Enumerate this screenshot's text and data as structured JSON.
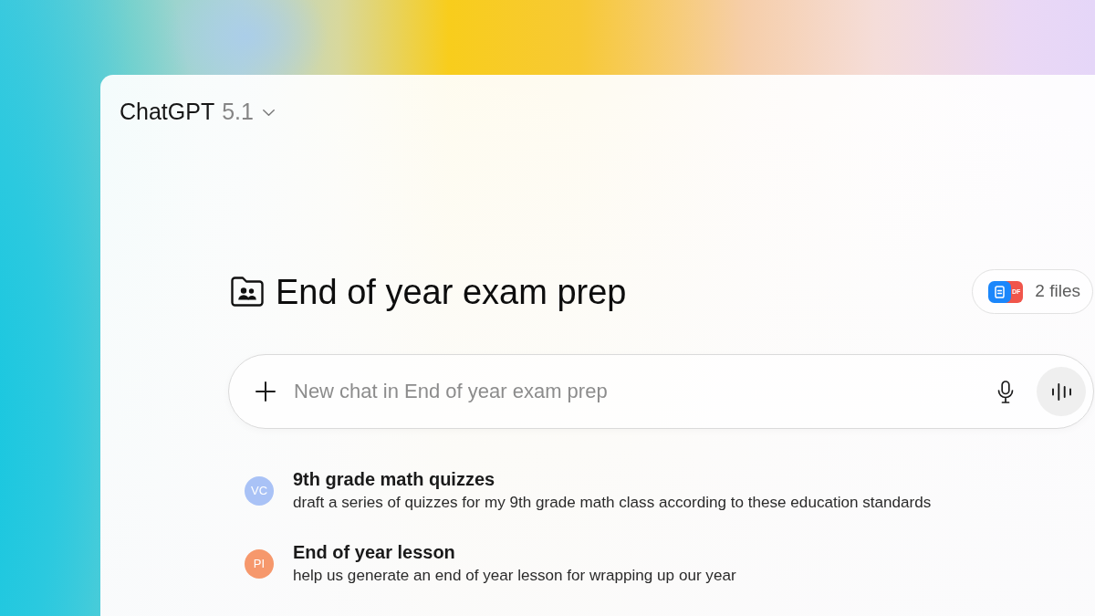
{
  "header": {
    "app_name": "ChatGPT",
    "version": "5.1"
  },
  "project": {
    "title": "End of year exam prep",
    "files": {
      "label": "2 files",
      "pdf_tag": "DF"
    }
  },
  "composer": {
    "placeholder": "New chat in End of year exam prep"
  },
  "chats": [
    {
      "initials": "VC",
      "color": "#a9c2f6",
      "title": "9th grade math quizzes",
      "snippet": "draft a series of quizzes for my 9th grade math class according to these education standards"
    },
    {
      "initials": "PI",
      "color": "#f6986c",
      "title": "End of year lesson",
      "snippet": "help us generate an end of year lesson for wrapping up our year"
    }
  ]
}
